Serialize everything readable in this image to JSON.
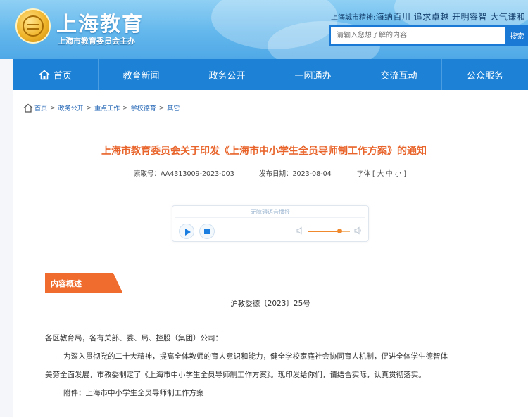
{
  "header": {
    "logo_title": "上海教育",
    "logo_sub": "上海市教育委员会主办",
    "spirit_label": "上海城市精神:",
    "spirit_text": "海纳百川 追求卓越 开明睿智 大气谦和",
    "search_placeholder": "请输入您想了解的内容",
    "search_button": "搜索"
  },
  "nav": {
    "items": [
      "首页",
      "教育新闻",
      "政务公开",
      "一网通办",
      "交流互动",
      "公众服务"
    ]
  },
  "breadcrumb": {
    "items": [
      "首页",
      "政务公开",
      "重点工作",
      "学校德育",
      "其它"
    ],
    "separator": ">"
  },
  "article": {
    "title": "上海市教育委员会关于印发《上海市中小学生全员导师制工作方案》的通知",
    "index_no": "索取号：AA4313009-2023-003",
    "publish_date": "发布日期：2023-08-04",
    "font_size": "字体 [ 大 中 小 ]"
  },
  "player": {
    "label": "无障碍语音播报",
    "volume": 0.75
  },
  "content": {
    "section_label": "内容概述",
    "doc_no": "沪教委德〔2023〕25号",
    "greeting": "各区教育局，各有关部、委、局、控股（集团）公司：",
    "para1_line1": "为深入贯彻党的二十大精神，提高全体教师的育人意识和能力，健全学校家庭社会协同育人机制，促进全体学生德智体",
    "para1_line2": "美劳全面发展，市教委制定了《上海市中小学生全员导师制工作方案》。现印发给你们，请结合实际，认真贯彻落实。",
    "attachment": "附件：上海市中小学生全员导师制工作方案"
  },
  "colors": {
    "nav_blue": "#1d82d6",
    "title_orange": "#e8642a",
    "tag_orange": "#ef6c2e",
    "link_blue": "#2366b5"
  }
}
